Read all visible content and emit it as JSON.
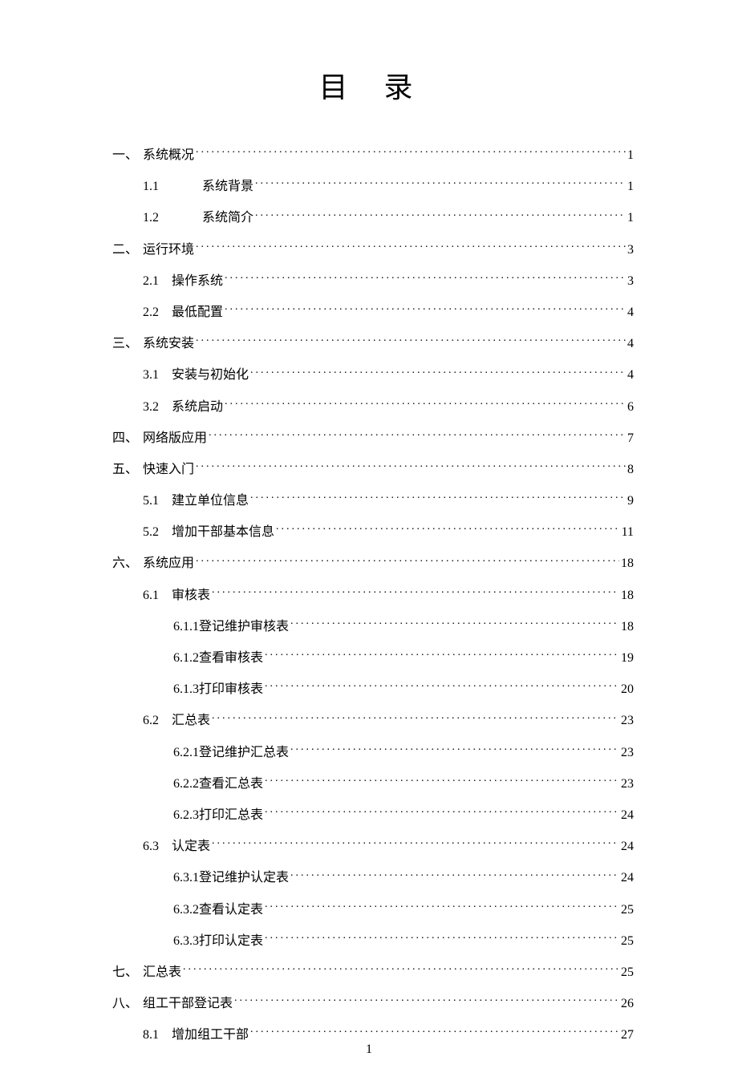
{
  "title": "目 录",
  "page_number": "1",
  "entries": [
    {
      "level": 1,
      "num": "一、",
      "label": "系统概况",
      "page": "1"
    },
    {
      "level": 2,
      "num": "1.1",
      "num_wide": true,
      "label": "系统背景",
      "page": "1"
    },
    {
      "level": 2,
      "num": "1.2",
      "num_wide": true,
      "label": "系统简介",
      "page": "1"
    },
    {
      "level": 1,
      "num": "二、",
      "label": "运行环境",
      "page": "3"
    },
    {
      "level": 2,
      "num": "2.1",
      "label": "操作系统",
      "page": "3"
    },
    {
      "level": 2,
      "num": "2.2",
      "label": "最低配置",
      "page": "4"
    },
    {
      "level": 1,
      "num": "三、",
      "label": "系统安装",
      "page": "4"
    },
    {
      "level": 2,
      "num": "3.1",
      "label": "安装与初始化",
      "page": "4"
    },
    {
      "level": 2,
      "num": "3.2",
      "label": "系统启动",
      "page": "6"
    },
    {
      "level": 1,
      "num": "四、",
      "label": "网络版应用",
      "page": "7"
    },
    {
      "level": 1,
      "num": "五、",
      "label": "快速入门",
      "page": "8"
    },
    {
      "level": 2,
      "num": "5.1",
      "label": "建立单位信息",
      "page": "9"
    },
    {
      "level": 2,
      "num": "5.2",
      "label": "增加干部基本信息",
      "page": "11"
    },
    {
      "level": 1,
      "num": "六、",
      "label": "系统应用",
      "page": "18"
    },
    {
      "level": 2,
      "num": "6.1",
      "label": "审核表",
      "page": "18"
    },
    {
      "level": 3,
      "num": "6.1.1",
      "label": "登记维护审核表",
      "page": "18"
    },
    {
      "level": 3,
      "num": "6.1.2",
      "label": "查看审核表",
      "page": "19"
    },
    {
      "level": 3,
      "num": "6.1.3",
      "label": "打印审核表",
      "page": "20"
    },
    {
      "level": 2,
      "num": "6.2",
      "label": "汇总表",
      "page": "23"
    },
    {
      "level": 3,
      "num": "6.2.1",
      "label": "登记维护汇总表",
      "page": "23"
    },
    {
      "level": 3,
      "num": "6.2.2",
      "label": "查看汇总表",
      "page": "23"
    },
    {
      "level": 3,
      "num": "6.2.3",
      "label": "打印汇总表",
      "page": "24"
    },
    {
      "level": 2,
      "num": "6.3",
      "label": "认定表",
      "page": "24"
    },
    {
      "level": 3,
      "num": "6.3.1",
      "label": "登记维护认定表",
      "page": "24"
    },
    {
      "level": 3,
      "num": "6.3.2",
      "label": "查看认定表",
      "page": "25"
    },
    {
      "level": 3,
      "num": "6.3.3",
      "label": "打印认定表",
      "page": "25"
    },
    {
      "level": 1,
      "num": "七、",
      "label": "汇总表",
      "page": "25"
    },
    {
      "level": 1,
      "num": "八、",
      "label": "组工干部登记表",
      "page": "26"
    },
    {
      "level": 2,
      "num": "8.1",
      "label": "增加组工干部",
      "page": "27"
    }
  ]
}
